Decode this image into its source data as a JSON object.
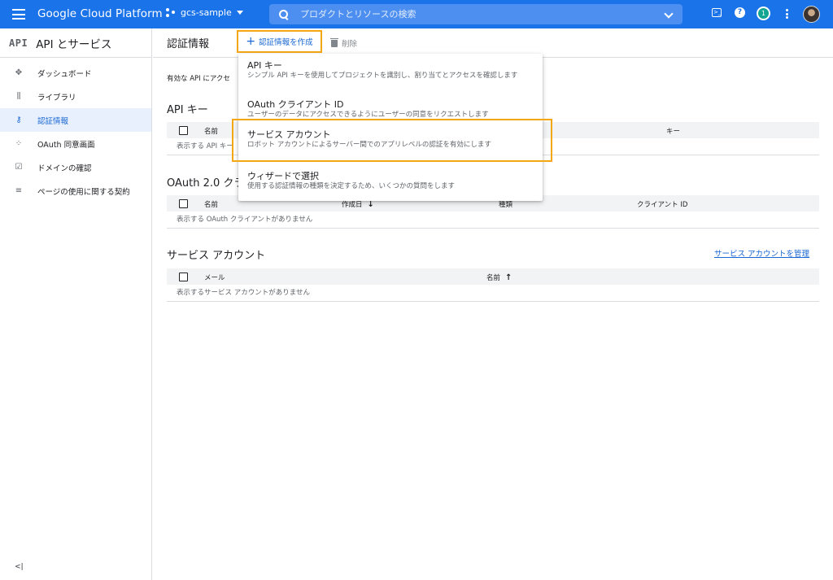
{
  "topbar": {
    "brand": "Google Cloud Platform",
    "project": "gcs-sample",
    "search_placeholder": "プロダクトとリソースの検索",
    "notification_count": "1",
    "help_glyph": "?",
    "terminal_glyph": ">_"
  },
  "sidebar": {
    "logo": "API",
    "title": "API とサービス",
    "items": [
      {
        "label": "ダッシュボード",
        "icon": "dashboard-icon",
        "glyph": "✥"
      },
      {
        "label": "ライブラリ",
        "icon": "library-icon",
        "glyph": "⫼"
      },
      {
        "label": "認証情報",
        "icon": "key-icon",
        "glyph": "⚷",
        "active": true
      },
      {
        "label": "OAuth 同意画面",
        "icon": "consent-screen-icon",
        "glyph": "⁘"
      },
      {
        "label": "ドメインの確認",
        "icon": "domain-verification-icon",
        "glyph": "☑"
      },
      {
        "label": "ページの使用に関する契約",
        "icon": "page-usage-agreement-icon",
        "glyph": "≡"
      }
    ],
    "collapse_glyph": "<|"
  },
  "main": {
    "title": "認証情報",
    "create_label": "認証情報を作成",
    "delete_label": "削除",
    "intro": "有効な API にアクセ",
    "api_keys": {
      "title": "API キー",
      "col_name": "名前",
      "col_key": "キー",
      "empty": "表示する API キー"
    },
    "oauth": {
      "title": "OAuth 2.0 クラ",
      "col_name": "名前",
      "col_created": "作成日",
      "col_type": "種類",
      "col_client_id": "クライアント ID",
      "empty": "表示する OAuth クライアントがありません"
    },
    "service_accounts": {
      "title": "サービス アカウント",
      "manage_link": "サービス アカウントを管理",
      "col_email": "メール",
      "col_name": "名前",
      "empty": "表示するサービス アカウントがありません"
    }
  },
  "dropdown": {
    "items": [
      {
        "title": "API キー",
        "desc": "シンプル API キーを使用してプロジェクトを識別し、割り当てとアクセスを確認します"
      },
      {
        "title": "OAuth クライアント ID",
        "desc": "ユーザーのデータにアクセスできるようにユーザーの同意をリクエストします"
      },
      {
        "title": "サービス アカウント",
        "desc": "ロボット アカウントによるサーバー間でのアプリレベルの認証を有効にします"
      },
      {
        "title": "ウィザードで選択",
        "desc": "使用する認証情報の種類を決定するため、いくつかの質問をします"
      }
    ]
  },
  "colors": {
    "topbar": "#1a73e8",
    "accent": "#1967d2",
    "highlight": "#f4a713",
    "active_bg": "#e8f0fe"
  }
}
